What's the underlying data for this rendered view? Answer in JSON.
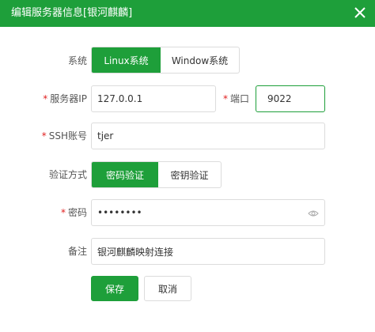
{
  "dialog": {
    "title": "编辑服务器信息[银河麒麟]",
    "close_icon": "close-icon"
  },
  "form": {
    "system": {
      "label": "系统",
      "options": [
        "Linux系统",
        "Window系统"
      ],
      "selected": "Linux系统"
    },
    "server_ip": {
      "required_mark": "*",
      "label": "服务器IP",
      "value": "127.0.0.1"
    },
    "port": {
      "required_mark": "*",
      "label": "端口",
      "value": "9022"
    },
    "ssh_account": {
      "required_mark": "*",
      "label": "SSH账号",
      "value": "tjer"
    },
    "auth_method": {
      "label": "验证方式",
      "options": [
        "密码验证",
        "密钥验证"
      ],
      "selected": "密码验证"
    },
    "password": {
      "required_mark": "*",
      "label": "密码",
      "value": "••••••••",
      "toggle_icon": "eye-icon"
    },
    "note": {
      "label": "备注",
      "value": "银河麒麟映射连接"
    }
  },
  "actions": {
    "save_label": "保存",
    "cancel_label": "取消"
  },
  "colors": {
    "accent": "#1e9f3a",
    "required": "#e02020",
    "border": "#dcdcdc"
  }
}
